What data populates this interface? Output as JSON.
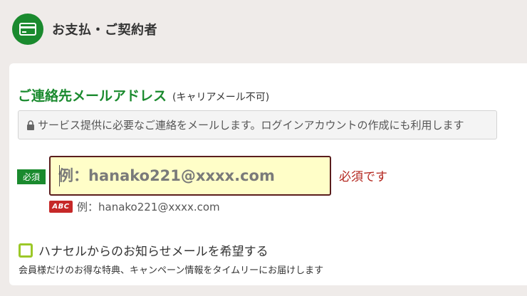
{
  "header": {
    "icon": "credit-card-icon",
    "title": "お支払・ご契約者"
  },
  "email_field": {
    "title": "ご連絡先メールアドレス",
    "title_note": "(キャリアメール不可)",
    "notice": "サービス提供に必要なご連絡をメールします。ログインアカウントの作成にも利用します",
    "required_label": "必須",
    "value": "",
    "placeholder": "例：hanako221@xxxx.com",
    "error": "必須です",
    "hint_badge": "ABC",
    "hint": "例：hanako221@xxxx.com"
  },
  "newsletter": {
    "label": "ハナセルからのお知らせメールを希望する",
    "description": "会員様だけのお得な特典、キャンペーン情報をタイムリーにお届けします",
    "checked": false
  },
  "colors": {
    "brand_green": "#1a8a2e",
    "error_red": "#b3261e",
    "input_bg": "#fffec8",
    "checkbox_border": "#9cc828"
  }
}
